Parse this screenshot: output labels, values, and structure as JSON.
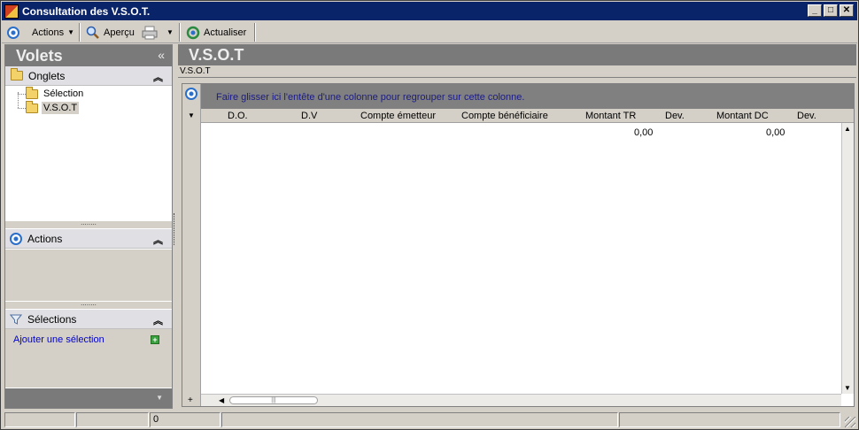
{
  "window": {
    "title": "Consultation des V.S.O.T."
  },
  "titlebar_buttons": {
    "minimize": "_",
    "maximize": "□",
    "close": "✕"
  },
  "toolbar": {
    "actions_label": "Actions",
    "apercu_label": "Aperçu",
    "actualiser_label": "Actualiser"
  },
  "left_panel": {
    "title": "Volets",
    "collapse": "«",
    "onglets": {
      "label": "Onglets",
      "items": [
        {
          "label": "Sélection"
        },
        {
          "label": "V.S.O.T"
        }
      ]
    },
    "actions": {
      "label": "Actions"
    },
    "selections": {
      "label": "Sélections",
      "add_link": "Ajouter une sélection"
    },
    "grip": "........",
    "chev": "«"
  },
  "right_panel": {
    "title": "V.S.O.T",
    "tab_label": "V.S.O.T",
    "group_hint": "Faire glisser ici l'entête d'une colonne pour regrouper sur cette colonne.",
    "columns": [
      "D.O.",
      "D.V",
      "Compte émetteur",
      "Compte bénéficiaire",
      "Montant TR",
      "Dev.",
      "Montant DC",
      "Dev."
    ],
    "totals": {
      "montant_tr": "0,00",
      "montant_dc": "0,00"
    }
  },
  "statusbar": {
    "count": "0"
  },
  "colors": {
    "titlebar": "#0a246a",
    "panel_header": "#7a7a7a",
    "link": "#0000cc"
  }
}
